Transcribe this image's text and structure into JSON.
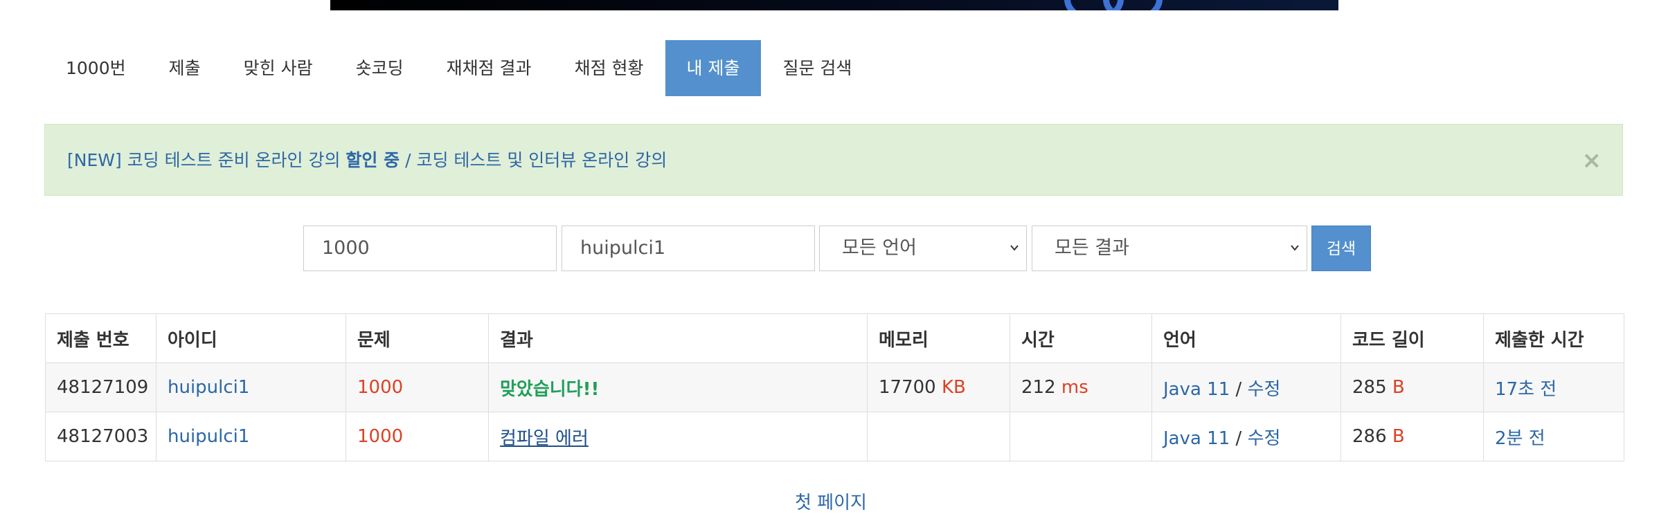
{
  "tabs": [
    {
      "label": "1000번",
      "active": false
    },
    {
      "label": "제출",
      "active": false
    },
    {
      "label": "맞힌 사람",
      "active": false
    },
    {
      "label": "숏코딩",
      "active": false
    },
    {
      "label": "재채점 결과",
      "active": false
    },
    {
      "label": "채점 현황",
      "active": false
    },
    {
      "label": "내 제출",
      "active": true
    },
    {
      "label": "질문 검색",
      "active": false
    }
  ],
  "alert": {
    "link1_prefix": "[NEW] 코딩 테스트 준비 온라인 강의 ",
    "link1_bold": "할인 중",
    "separator": " / ",
    "link2": "코딩 테스트 및 인터뷰 온라인 강의",
    "close": "×"
  },
  "search": {
    "problem_value": "1000",
    "user_value": "huipulci1",
    "language_selected": "모든 언어",
    "result_selected": "모든 결과",
    "button": "검색"
  },
  "table": {
    "headers": [
      "제출 번호",
      "아이디",
      "문제",
      "결과",
      "메모리",
      "시간",
      "언어",
      "코드 길이",
      "제출한 시간"
    ],
    "rows": [
      {
        "id": "48127109",
        "user": "huipulci1",
        "problem": "1000",
        "result": "맞았습니다!!",
        "memory": "17700",
        "memory_unit": "KB",
        "time": "212",
        "time_unit": "ms",
        "lang": "Java 11",
        "lang_sep": " / ",
        "edit": "수정",
        "length": "285",
        "length_unit": "B",
        "submitted": "17초 전"
      },
      {
        "id": "48127003",
        "user": "huipulci1",
        "problem": "1000",
        "result": "컴파일 에러",
        "memory": "",
        "memory_unit": "",
        "time": "",
        "time_unit": "",
        "lang": "Java 11",
        "lang_sep": " / ",
        "edit": "수정",
        "length": "286",
        "length_unit": "B",
        "submitted": "2분 전"
      }
    ]
  },
  "pager": {
    "first_page": "첫 페이지"
  },
  "colors": {
    "accent": "#5390cd",
    "link": "#2c67a6",
    "accepted": "#229e5b",
    "unit": "#dd4124",
    "alert_bg": "#e0efd8"
  }
}
